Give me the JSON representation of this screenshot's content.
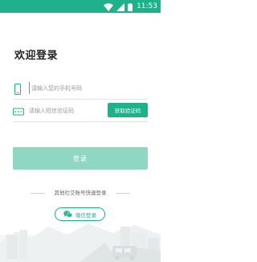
{
  "status_bar": {
    "time": "11:53",
    "icons": [
      "wifi-icon",
      "signal-icon",
      "battery-icon"
    ],
    "background": "#1fb08c"
  },
  "login": {
    "title": "欢迎登录",
    "phone_placeholder": "请输入您的手机号码",
    "code_placeholder": "请输入短信验证码",
    "get_code_label": "获取验证码",
    "login_label": "登录",
    "other_login_text": "其他社交账号快速登录",
    "wechat_label": "微信登录"
  },
  "colors": {
    "accent": "#1fb08c",
    "login_button_disabled": "#8fd7c2",
    "divider": "#e2e2e2"
  }
}
